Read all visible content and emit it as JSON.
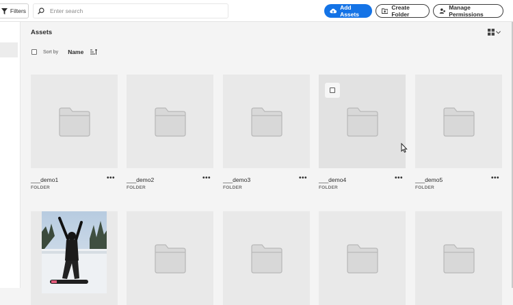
{
  "toolbar": {
    "filters_label": "Filters",
    "search_placeholder": "Enter search",
    "add_assets_label": "Add Assets",
    "create_folder_label": "Create Folder",
    "manage_permissions_label": "Manage Permissions"
  },
  "page": {
    "title": "Assets",
    "sort_by_label": "Sort by",
    "sort_field": "Name"
  },
  "icons": {
    "filter": "filter-icon",
    "search": "search-icon",
    "upload": "cloud-upload-icon",
    "folder_add": "folder-add-icon",
    "permissions": "user-permissions-icon",
    "grid": "grid-view-icon",
    "sort": "sort-ascending-icon",
    "folder": "folder-icon"
  },
  "colors": {
    "accent": "#1473e6",
    "folder_fill": "#d8d8d8",
    "thumb_bg": "#e9e9e9"
  },
  "assets": [
    {
      "name": "___demo1",
      "type": "FOLDER"
    },
    {
      "name": "___demo2",
      "type": "FOLDER"
    },
    {
      "name": "___demo3",
      "type": "FOLDER"
    },
    {
      "name": "___demo4",
      "type": "FOLDER"
    },
    {
      "name": "___demo5",
      "type": "FOLDER"
    },
    {
      "kind": "image"
    },
    {
      "kind": "folder"
    },
    {
      "kind": "folder"
    },
    {
      "kind": "folder"
    },
    {
      "kind": "folder"
    }
  ]
}
